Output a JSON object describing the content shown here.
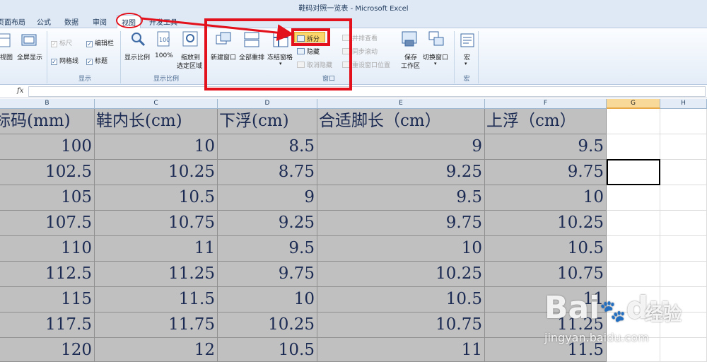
{
  "window": {
    "title": "鞋码对照一览表 - Microsoft Excel"
  },
  "tabs": [
    "页面布局",
    "公式",
    "数据",
    "审阅",
    "视图",
    "开发工具"
  ],
  "active_tab": "视图",
  "ribbon": {
    "views": {
      "normal": "视图",
      "fullscreen": "全屏显示"
    },
    "show": {
      "ruler": "标尺",
      "formula_bar": "编辑栏",
      "gridlines": "网格线",
      "headings": "标题",
      "label": "显示"
    },
    "zoom": {
      "zoom": "显示比例",
      "hundred": "100%",
      "zoom_sel_1": "缩放到",
      "zoom_sel_2": "选定区域",
      "label": "显示比例"
    },
    "window": {
      "new_window": "新建窗口",
      "arrange_all": "全部重排",
      "freeze_panes": "冻结窗格",
      "split": "拆分",
      "hide": "隐藏",
      "unhide": "取消隐藏",
      "side_by_side": "并排查看",
      "sync_scroll": "同步滚动",
      "reset_position": "重设窗口位置",
      "save_workspace_1": "保存",
      "save_workspace_2": "工作区",
      "switch_windows": "切换窗口",
      "label": "窗口"
    },
    "macros": {
      "macros": "宏",
      "label": "宏"
    }
  },
  "formula_bar": {
    "fx": "fx",
    "value": ""
  },
  "columns": [
    "B",
    "C",
    "D",
    "E",
    "F",
    "G",
    "H"
  ],
  "selected_column": "G",
  "sheet": {
    "headers": [
      "标码(mm)",
      "鞋内长(cm)",
      "下浮(cm)",
      "合适脚长（cm）",
      "上浮（cm）"
    ],
    "rows": [
      [
        "100",
        "10",
        "8.5",
        "9",
        "9.5"
      ],
      [
        "102.5",
        "10.25",
        "8.75",
        "9.25",
        "9.75"
      ],
      [
        "105",
        "10.5",
        "9",
        "9.5",
        "10"
      ],
      [
        "107.5",
        "10.75",
        "9.25",
        "9.75",
        "10.25"
      ],
      [
        "110",
        "11",
        "9.5",
        "10",
        "10.5"
      ],
      [
        "112.5",
        "11.25",
        "9.75",
        "10.25",
        "10.75"
      ],
      [
        "115",
        "11.5",
        "10",
        "10.5",
        "11"
      ],
      [
        "117.5",
        "11.75",
        "10.25",
        "10.75",
        "11.25"
      ],
      [
        "120",
        "12",
        "10.5",
        "11",
        "11.5"
      ]
    ]
  },
  "watermark": {
    "brand": "Bai",
    "brand2": "du",
    "cn": "经验",
    "url": "jingyan.baidu.com"
  },
  "colors": {
    "annotation_red": "#e3111b",
    "selection_gray": "#c0c0c0",
    "header_orange": "#f9d99a"
  }
}
